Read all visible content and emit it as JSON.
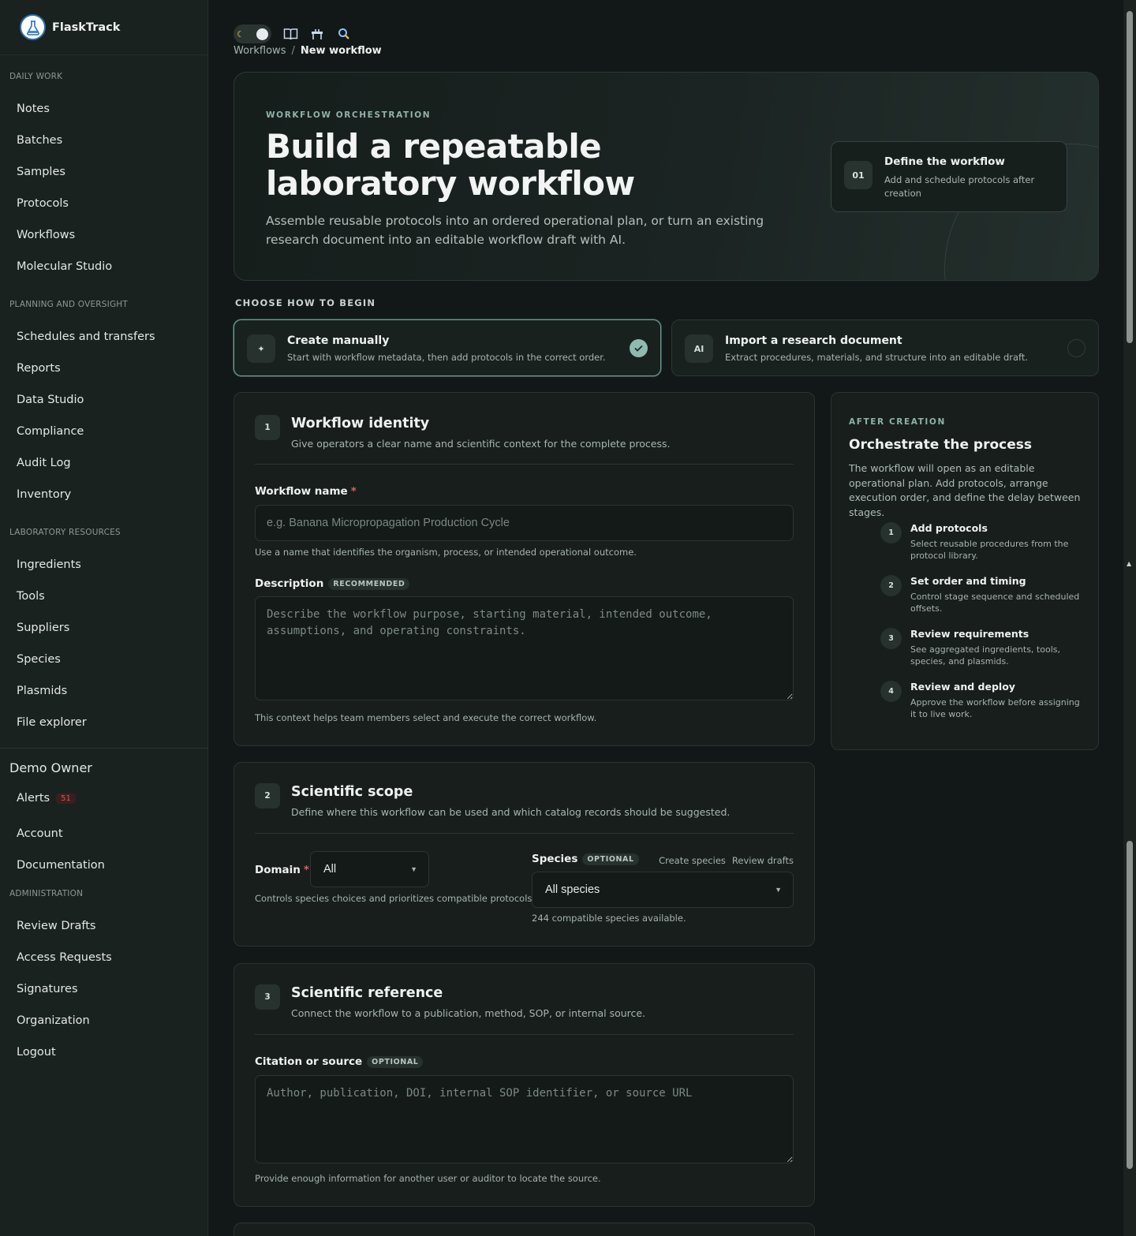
{
  "app": {
    "name": "FlaskTrack"
  },
  "sidebar": {
    "daily_work": {
      "heading": "DAILY WORK",
      "items": [
        "Notes",
        "Batches",
        "Samples",
        "Protocols",
        "Workflows",
        "Molecular Studio"
      ]
    },
    "planning": {
      "heading": "PLANNING AND OVERSIGHT",
      "items": [
        "Schedules and transfers",
        "Reports",
        "Data Studio",
        "Compliance",
        "Audit Log",
        "Inventory"
      ]
    },
    "resources": {
      "heading": "LABORATORY RESOURCES",
      "items": [
        "Ingredients",
        "Tools",
        "Suppliers",
        "Species",
        "Plasmids",
        "File explorer"
      ]
    },
    "user": {
      "name": "Demo Owner",
      "alerts_label": "Alerts",
      "alerts_count": "51",
      "account": "Account",
      "documentation": "Documentation"
    },
    "administration": {
      "heading": "ADMINISTRATION",
      "items": [
        "Review Drafts",
        "Access Requests",
        "Signatures",
        "Organization",
        "Logout"
      ]
    }
  },
  "breadcrumb": {
    "parent": "Workflows",
    "separator": "/",
    "current": "New workflow"
  },
  "hero": {
    "eyebrow": "WORKFLOW ORCHESTRATION",
    "title": "Build a repeatable laboratory workflow",
    "description": "Assemble reusable protocols into an ordered operational plan, or turn an existing research document into an editable workflow draft with AI.",
    "card": {
      "number": "01",
      "title": "Define the workflow",
      "subtitle": "Add and schedule protocols after creation"
    }
  },
  "choose": {
    "label": "CHOOSE HOW TO BEGIN",
    "manual": {
      "icon": "✦",
      "title": "Create manually",
      "description": "Start with workflow metadata, then add protocols in the correct order.",
      "selected": true
    },
    "import": {
      "icon": "AI",
      "title": "Import a research document",
      "description": "Extract procedures, materials, and structure into an editable draft.",
      "selected": false
    }
  },
  "identity": {
    "number": "1",
    "title": "Workflow identity",
    "subtitle": "Give operators a clear name and scientific context for the complete process.",
    "name_label": "Workflow name",
    "required_mark": "*",
    "name_placeholder": "e.g. Banana Micropropagation Production Cycle",
    "name_value": "",
    "name_help": "Use a name that identifies the organism, process, or intended operational outcome.",
    "desc_label": "Description",
    "desc_pill": "RECOMMENDED",
    "desc_placeholder": "Describe the workflow purpose, starting material, intended outcome, assumptions, and operating constraints.",
    "desc_help": "This context helps team members select and execute the correct workflow."
  },
  "scope": {
    "number": "2",
    "title": "Scientific scope",
    "subtitle": "Define where this workflow can be used and which catalog records should be suggested.",
    "domain_label": "Domain",
    "required_mark": "*",
    "domain_value": "All",
    "domain_help": "Controls species choices and prioritizes compatible protocols.",
    "species_label": "Species",
    "species_pill": "OPTIONAL",
    "create_species": "Create species",
    "review_drafts": "Review drafts",
    "species_value": "All species",
    "species_help": "244 compatible species available."
  },
  "reference": {
    "number": "3",
    "title": "Scientific reference",
    "subtitle": "Connect the workflow to a publication, method, SOP, or internal source.",
    "citation_label": "Citation or source",
    "citation_pill": "OPTIONAL",
    "citation_placeholder": "Author, publication, DOI, internal SOP identifier, or source URL",
    "citation_help": "Provide enough information for another user or auditor to locate the source."
  },
  "panel": {
    "eyebrow": "AFTER CREATION",
    "title": "Orchestrate the process",
    "description": "The workflow will open as an editable operational plan. Add protocols, arrange execution order, and define the delay between stages.",
    "steps": [
      {
        "n": "1",
        "title": "Add protocols",
        "sub": "Select reusable procedures from the protocol library."
      },
      {
        "n": "2",
        "title": "Set order and timing",
        "sub": "Control stage sequence and scheduled offsets."
      },
      {
        "n": "3",
        "title": "Review requirements",
        "sub": "See aggregated ingredients, tools, species, and plasmids."
      },
      {
        "n": "4",
        "title": "Review and deploy",
        "sub": "Approve the workflow before assigning it to live work."
      }
    ]
  }
}
